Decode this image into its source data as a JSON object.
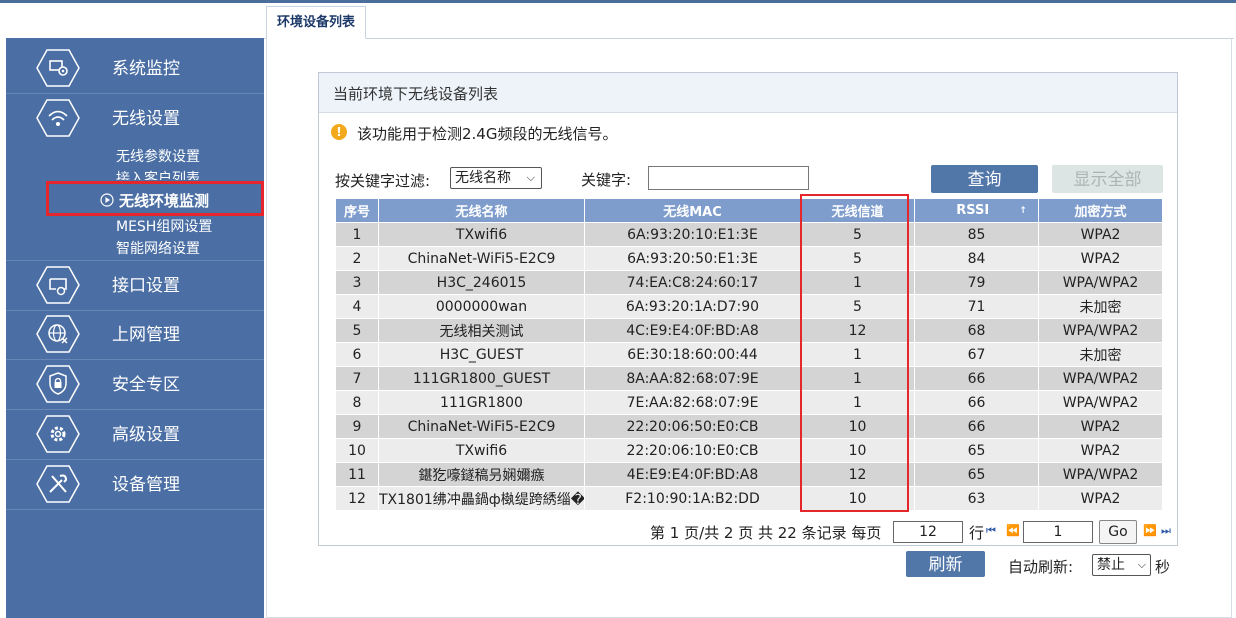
{
  "tab": {
    "label": "环境设备列表"
  },
  "sidebar": {
    "items": [
      {
        "label": "系统监控",
        "icon": "monitor-gear-icon"
      },
      {
        "label": "无线设置",
        "icon": "wifi-icon"
      },
      {
        "label": "接口设置",
        "icon": "interface-gear-icon"
      },
      {
        "label": "上网管理",
        "icon": "globe-icon"
      },
      {
        "label": "安全专区",
        "icon": "lock-shield-icon"
      },
      {
        "label": "高级设置",
        "icon": "gear-icon"
      },
      {
        "label": "设备管理",
        "icon": "tools-icon"
      }
    ],
    "submenu": [
      {
        "label": "无线参数设置"
      },
      {
        "label": "接入客户列表"
      },
      {
        "label": "无线环境监测",
        "active": true
      },
      {
        "label": "MESH组网设置"
      },
      {
        "label": "智能网络设置"
      }
    ]
  },
  "panel": {
    "title": "当前环境下无线设备列表",
    "notice": "该功能用于检测2.4G频段的无线信号。",
    "filter_label": "按关键字过滤:",
    "filter_value": "无线名称",
    "keyword_label": "关键字:",
    "keyword_value": "",
    "query_button": "查询",
    "show_all_button": "显示全部"
  },
  "table": {
    "headers": [
      "序号",
      "无线名称",
      "无线MAC",
      "无线信道",
      "RSSI",
      "加密方式"
    ],
    "rows": [
      [
        "1",
        "TXwifi6",
        "6A:93:20:10:E1:3E",
        "5",
        "85",
        "WPA2"
      ],
      [
        "2",
        "ChinaNet-WiFi5-E2C9",
        "6A:93:20:50:E1:3E",
        "5",
        "84",
        "WPA2"
      ],
      [
        "3",
        "H3C_246015",
        "74:EA:C8:24:60:17",
        "1",
        "79",
        "WPA/WPA2"
      ],
      [
        "4",
        "0000000wan",
        "6A:93:20:1A:D7:90",
        "5",
        "71",
        "未加密"
      ],
      [
        "5",
        "无线相关测试",
        "4C:E9:E4:0F:BD:A8",
        "12",
        "68",
        "WPA/WPA2"
      ],
      [
        "6",
        "H3C_GUEST",
        "6E:30:18:60:00:44",
        "1",
        "67",
        "未加密"
      ],
      [
        "7",
        "111GR1800_GUEST",
        "8A:AA:82:68:07:9E",
        "1",
        "66",
        "WPA/WPA2"
      ],
      [
        "8",
        "111GR1800",
        "7E:AA:82:68:07:9E",
        "1",
        "66",
        "WPA/WPA2"
      ],
      [
        "9",
        "ChinaNet-WiFi5-E2C9",
        "22:20:06:50:E0:CB",
        "10",
        "66",
        "WPA2"
      ],
      [
        "10",
        "TXwifi6",
        "22:20:06:10:E0:CB",
        "10",
        "65",
        "WPA2"
      ],
      [
        "11",
        "鍖犵嚎鐩稿叧娴嬭瘯",
        "4E:E9:E4:0F:BD:A8",
        "12",
        "65",
        "WPA/WPA2"
      ],
      [
        "12",
        "TX1801绋冲畾鍋ф槸缇跨綉缁�",
        "F2:10:90:1A:B2:DD",
        "10",
        "63",
        "WPA2"
      ]
    ]
  },
  "pager": {
    "summary": "第 1 页/共 2 页 共 22 条记录 每页",
    "per_page": "12",
    "row_unit": "行",
    "page_value": "1",
    "go_button": "Go"
  },
  "footer": {
    "refresh_button": "刷新",
    "auto_refresh_label": "自动刷新:",
    "auto_refresh_value": "禁止",
    "unit": "秒"
  }
}
